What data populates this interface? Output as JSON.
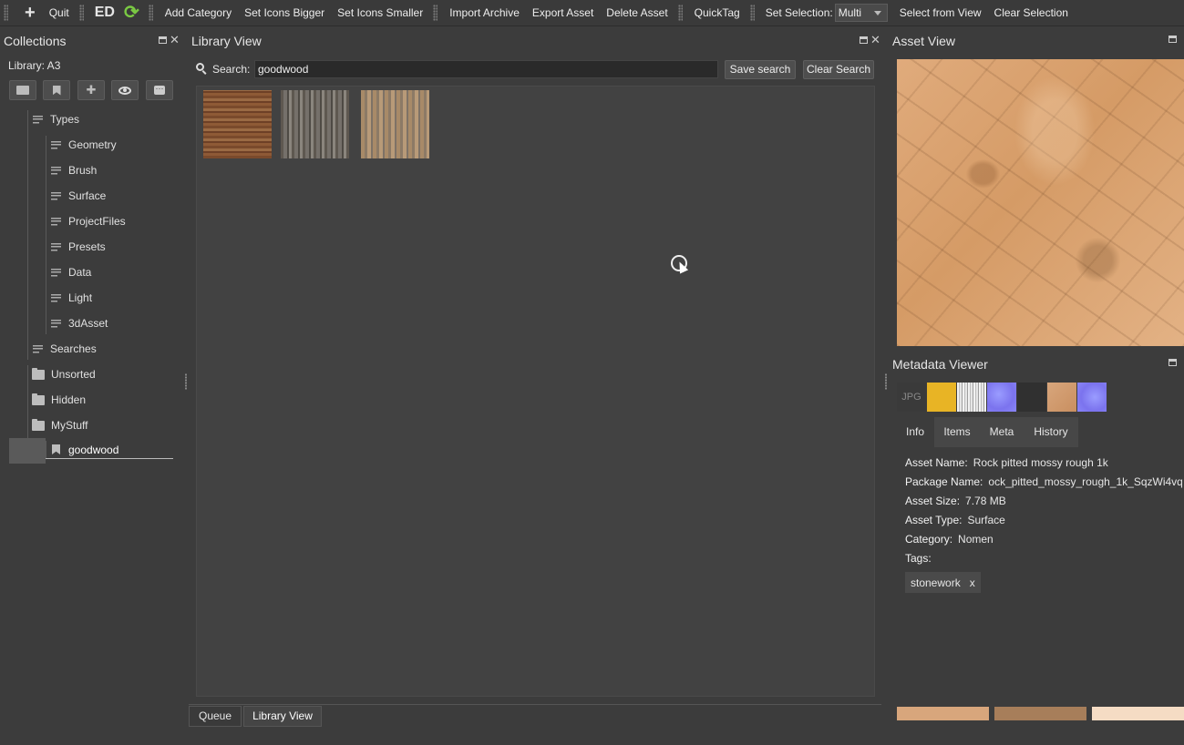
{
  "toolbar": {
    "add_label": "+",
    "quit_label": "Quit",
    "ed_label": "ED",
    "refresh_glyph": "⟳",
    "add_category": "Add Category",
    "icons_bigger": "Set Icons Bigger",
    "icons_smaller": "Set Icons Smaller",
    "import_archive": "Import Archive",
    "export_asset": "Export Asset",
    "delete_asset": "Delete Asset",
    "quicktag": "QuickTag",
    "set_selection_label": "Set Selection:",
    "selection_value": "Multi",
    "select_from_view": "Select from View",
    "clear_selection": "Clear Selection"
  },
  "collections": {
    "title": "Collections",
    "library_label": "Library: A3",
    "tree": {
      "types": "Types",
      "type_items": [
        "Geometry",
        "Brush",
        "Surface",
        "ProjectFiles",
        "Presets",
        "Data",
        "Light",
        "3dAsset"
      ],
      "searches": "Searches",
      "unsorted": "Unsorted",
      "hidden": "Hidden",
      "mystuff": "MyStuff",
      "saved_search": "goodwood"
    }
  },
  "library_view": {
    "title": "Library View",
    "search_label": "Search:",
    "search_value": "goodwood",
    "save_search": "Save search",
    "clear_search": "Clear Search",
    "bottom_tabs": [
      "Queue",
      "Library View"
    ]
  },
  "asset_view": {
    "title": "Asset View"
  },
  "metadata": {
    "title": "Metadata Viewer",
    "jpg_label": "JPG",
    "tabs": [
      "Info",
      "Items",
      "Meta",
      "History"
    ],
    "asset_name_label": "Asset Name:",
    "asset_name": "Rock pitted mossy rough 1k",
    "package_name_label": "Package Name:",
    "package_name": "ock_pitted_mossy_rough_1k_SqzWi4vq",
    "asset_size_label": "Asset Size:",
    "asset_size": "7.78 MB",
    "asset_type_label": "Asset Type:",
    "asset_type": "Surface",
    "category_label": "Category:",
    "category": "Nomen",
    "tags_label": "Tags:",
    "tag": "stonework",
    "tag_remove": "x"
  },
  "colors": {
    "accent_green": "#7ac943",
    "swatches": [
      "#d8a67c",
      "#a77e5a",
      "#f5dcc4"
    ]
  }
}
